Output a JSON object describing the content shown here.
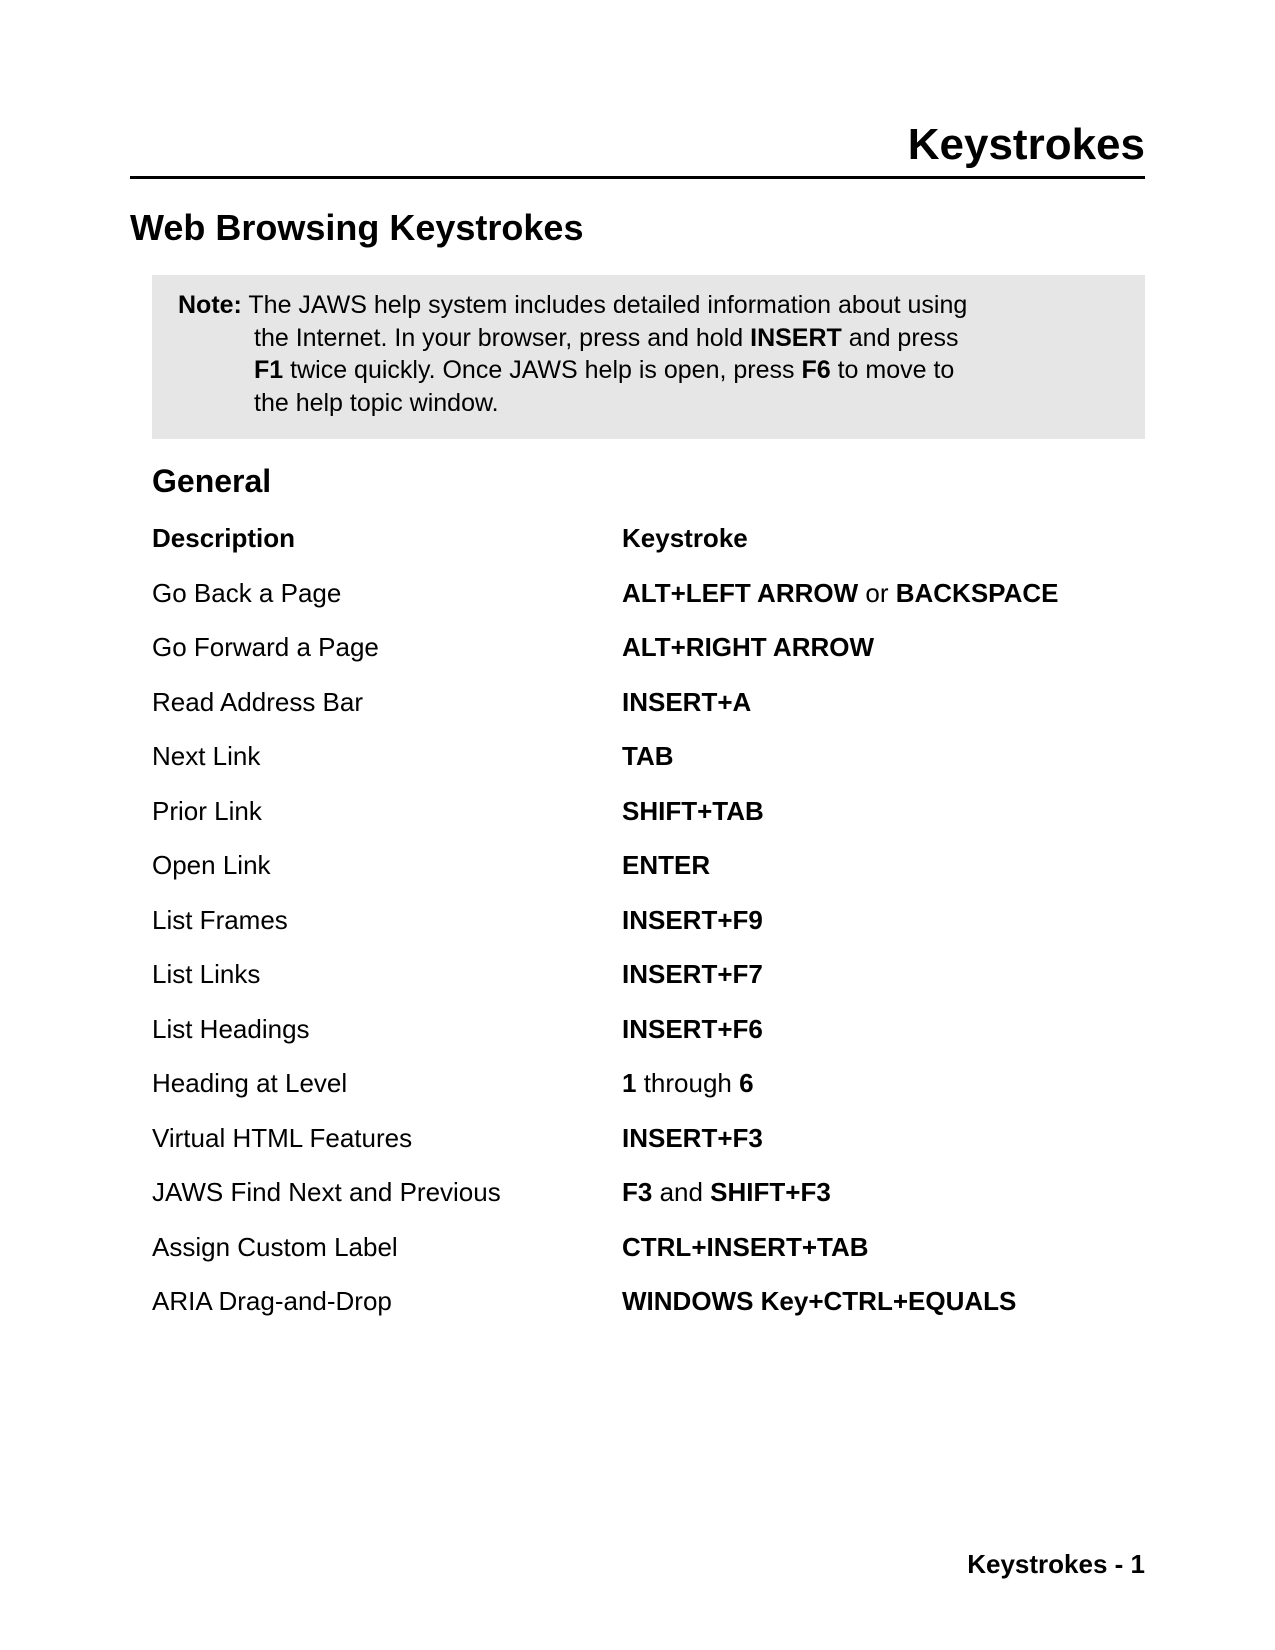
{
  "doc_title": "Keystrokes",
  "section_title": "Web Browsing Keystrokes",
  "note": {
    "label": "Note:",
    "l1a": "The JAWS help system includes detailed information about using",
    "l2a": "the Internet. In your browser, press and hold ",
    "l2b": "INSERT",
    "l2c": " and press",
    "l3a": "F1",
    "l3b": " twice quickly. Once JAWS help is open, press ",
    "l3c": "F6",
    "l3d": " to move to",
    "l4a": "the help topic window."
  },
  "subsection_title": "General",
  "headers": {
    "desc": "Description",
    "key": "Keystroke"
  },
  "rows": [
    {
      "desc": "Go Back a Page",
      "key": [
        {
          "t": "ALT+LEFT ARROW",
          "b": true
        },
        {
          "t": " or ",
          "b": false
        },
        {
          "t": "BACKSPACE",
          "b": true
        }
      ]
    },
    {
      "desc": "Go Forward a Page",
      "key": [
        {
          "t": "ALT+RIGHT ARROW",
          "b": true
        }
      ]
    },
    {
      "desc": "Read Address Bar",
      "key": [
        {
          "t": "INSERT+A",
          "b": true
        }
      ]
    },
    {
      "desc": "Next Link",
      "key": [
        {
          "t": "TAB",
          "b": true
        }
      ]
    },
    {
      "desc": "Prior Link",
      "key": [
        {
          "t": "SHIFT+TAB",
          "b": true
        }
      ]
    },
    {
      "desc": "Open Link",
      "key": [
        {
          "t": "ENTER",
          "b": true
        }
      ]
    },
    {
      "desc": "List Frames",
      "key": [
        {
          "t": "INSERT+F9",
          "b": true
        }
      ]
    },
    {
      "desc": "List Links",
      "key": [
        {
          "t": "INSERT+F7",
          "b": true
        }
      ]
    },
    {
      "desc": "List Headings",
      "key": [
        {
          "t": "INSERT+F6",
          "b": true
        }
      ]
    },
    {
      "desc": "Heading at Level",
      "key": [
        {
          "t": "1",
          "b": true
        },
        {
          "t": " through ",
          "b": false
        },
        {
          "t": "6",
          "b": true
        }
      ]
    },
    {
      "desc": "Virtual HTML Features",
      "key": [
        {
          "t": "INSERT+F3",
          "b": true
        }
      ]
    },
    {
      "desc": "JAWS Find Next and Previous",
      "key": [
        {
          "t": "F3",
          "b": true
        },
        {
          "t": " and ",
          "b": false
        },
        {
          "t": "SHIFT+F3",
          "b": true
        }
      ]
    },
    {
      "desc": "Assign Custom Label",
      "key": [
        {
          "t": "CTRL+INSERT+TAB",
          "b": true
        }
      ]
    },
    {
      "desc": "ARIA Drag-and-Drop",
      "key": [
        {
          "t": "WINDOWS Key+CTRL+EQUALS",
          "b": true
        }
      ]
    }
  ],
  "footer": "Keystrokes - 1"
}
